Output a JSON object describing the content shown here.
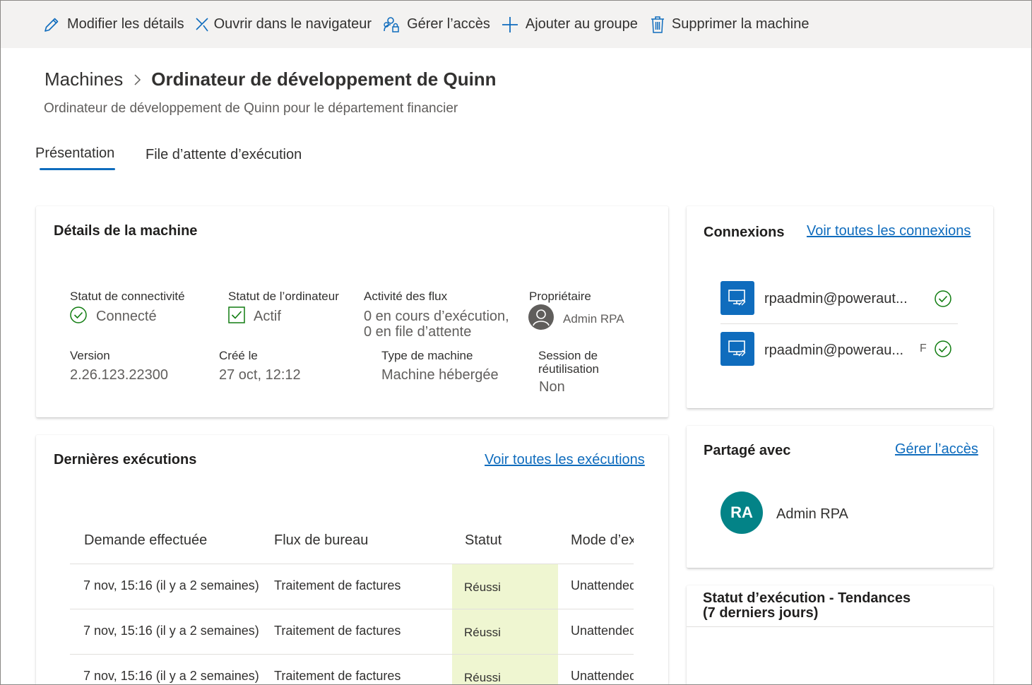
{
  "toolbar": {
    "edit_label": "Modifier les détails",
    "open_label": "Ouvrir dans le navigateur",
    "manage_label": "Gérer l’accès",
    "add_group_label": "Ajouter au groupe",
    "delete_label": "Supprimer la machine"
  },
  "breadcrumb": {
    "root": "Machines",
    "current": "Ordinateur de développement de Quinn"
  },
  "subtitle": "Ordinateur de développement de Quinn pour le département financier",
  "tabs": [
    "Présentation",
    "File d’attente d’exécution"
  ],
  "details": {
    "title": "Détails de la machine",
    "connectivity_label": "Statut de connectivité",
    "connectivity_value": "Connecté",
    "computer_status_label": "Statut de l’ordinateur",
    "computer_status_value": "Actif",
    "flow_activity_label": "Activité des flux",
    "flow_activity_line1": "0 en cours d’exécution,",
    "flow_activity_line2": "0 en file d’attente",
    "owner_label": "Propriétaire",
    "owner_value": "Admin RPA",
    "version_label": "Version",
    "version_value": "2.26.123.22300",
    "created_label": "Créé le",
    "created_value": "27 oct, 12:12",
    "machine_type_label": "Type de machine",
    "machine_type_value": "Machine hébergée",
    "reuse_label_line1": "Session de",
    "reuse_label_line2": "réutilisation",
    "reuse_value": "Non"
  },
  "runs": {
    "title": "Dernières exécutions",
    "link": "Voir toutes les exécutions",
    "columns": [
      "Demande effectuée",
      "Flux de bureau",
      "Statut",
      "Mode d’exécution"
    ],
    "rows": [
      {
        "requested": "7 nov, 15:16 (il y a 2 semaines)",
        "flow": "Traitement de factures",
        "status": "Réussi",
        "mode": "Unattended"
      },
      {
        "requested": "7 nov, 15:16 (il y a 2 semaines)",
        "flow": "Traitement de factures",
        "status": "Réussi",
        "mode": "Unattended"
      },
      {
        "requested": "7 nov, 15:16 (il y a 2 semaines)",
        "flow": "Traitement de factures",
        "status": "Réussi",
        "mode": "Unattended"
      }
    ]
  },
  "connections": {
    "title": "Connexions",
    "link": "Voir toutes les connexions",
    "items": [
      {
        "name": "rpaadmin@poweraut..."
      },
      {
        "name": "rpaadmin@powerau..."
      }
    ],
    "truncated_char": "F"
  },
  "shared": {
    "title": "Partagé avec",
    "link": "Gérer l’accès",
    "user_initials": "RA",
    "user_name": "Admin RPA"
  },
  "trends": {
    "title_line1": "Statut d’exécution - Tendances",
    "title_line2": "(7 derniers jours)"
  },
  "colors": {
    "accent": "#0f6cbd",
    "success": "#107c10",
    "status_cell_bg": "#eff6d1",
    "avatar_bg": "#038387"
  }
}
